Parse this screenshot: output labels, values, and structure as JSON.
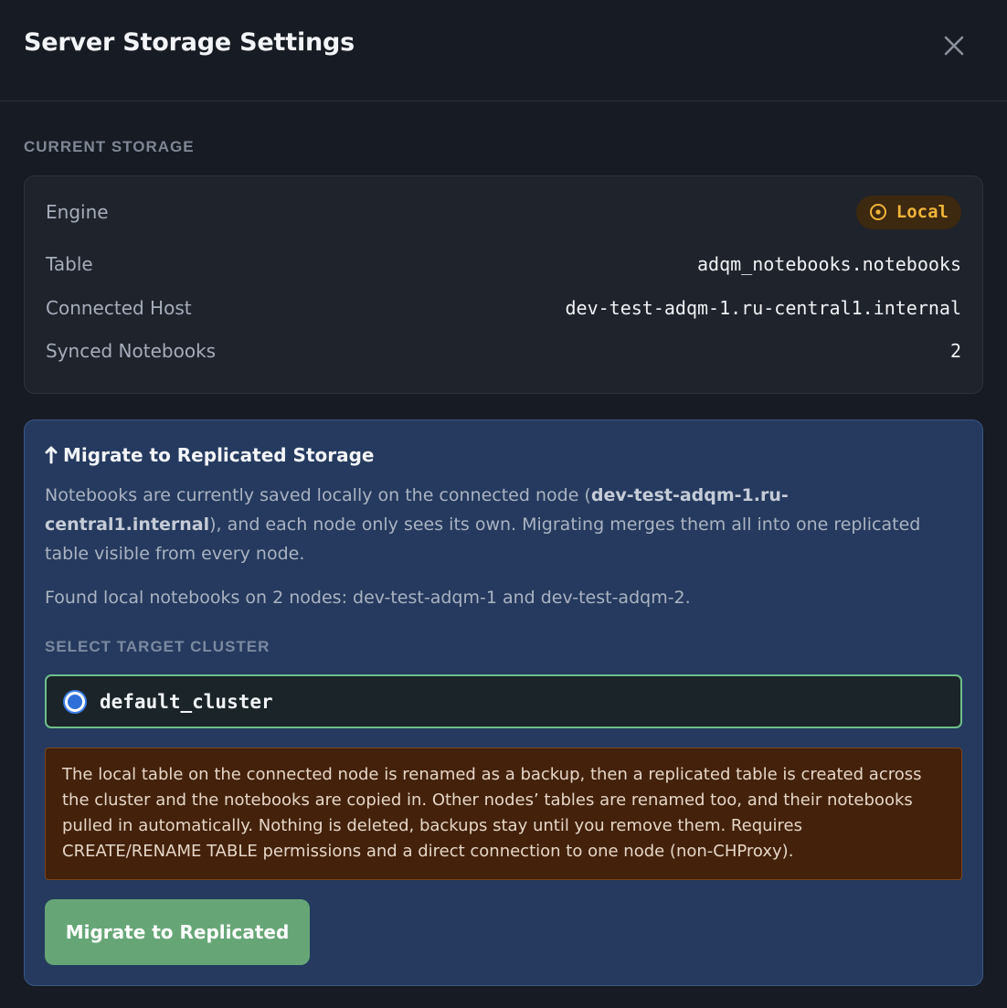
{
  "header": {
    "title": "Server Storage Settings",
    "close_icon": "close-icon"
  },
  "current_storage": {
    "section_label": "CURRENT STORAGE",
    "rows": [
      {
        "label": "Engine",
        "value": "Local",
        "icon": "radio-circle-icon",
        "badge_color": "#f0b43a"
      },
      {
        "label": "Table",
        "value": "adqm_notebooks.notebooks"
      },
      {
        "label": "Connected Host",
        "value": "dev-test-adqm-1.ru-central1.internal"
      },
      {
        "label": "Synced Notebooks",
        "value": "2"
      }
    ]
  },
  "migrate": {
    "icon": "arrow-up-icon",
    "title": "Migrate to Replicated Storage",
    "desc_part1": "Notebooks are currently saved locally on the connected node (",
    "desc_host": "dev-test-adqm-1.ru-central1.internal",
    "desc_part2": "), and each node only sees its own. Migrating merges them all into one replicated table visible from every node.",
    "found_text": "Found local notebooks on 2 nodes: dev-test-adqm-1 and dev-test-adqm-2.",
    "select_label": "SELECT TARGET CLUSTER",
    "cluster_option": "default_cluster",
    "cluster_selected": true,
    "warning_text": "The local table on the connected node is renamed as a backup, then a replicated table is created across the cluster and the notebooks are copied in. Other nodes’ tables are renamed too, and their notebooks pulled in automatically. Nothing is deleted, backups stay until you remove them. Requires CREATE/RENAME TABLE permissions and a direct connection to one node (non-CHProxy).",
    "button_label": "Migrate to Replicated",
    "accent_color": "#66a676"
  }
}
